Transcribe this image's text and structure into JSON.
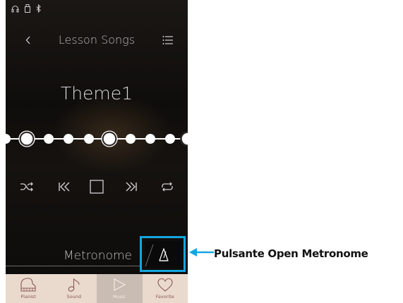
{
  "status_bar": {
    "icons": [
      "headphones-icon",
      "usb-memory-icon",
      "bluetooth-icon"
    ]
  },
  "header": {
    "title": "Lesson Songs",
    "back_icon": "chevron-left-icon",
    "menu_icon": "list-icon"
  },
  "song": {
    "title": "Theme1"
  },
  "progress": {
    "dot_count": 9,
    "selected_dots": [
      1,
      5
    ]
  },
  "controls": [
    "shuffle-icon",
    "skip-back-icon",
    "stop-icon",
    "skip-forward-icon",
    "repeat-icon"
  ],
  "metronome": {
    "label": "Metronome"
  },
  "tabs": [
    {
      "label": "Pianist",
      "icon": "piano-icon",
      "active": false
    },
    {
      "label": "Sound",
      "icon": "music-note-icon",
      "active": false
    },
    {
      "label": "Music",
      "icon": "play-icon",
      "active": true
    },
    {
      "label": "Favorite",
      "icon": "heart-icon",
      "active": false
    }
  ],
  "annotation": {
    "label": "Pulsante Open Metronome"
  },
  "colors": {
    "accent": "#13a6df",
    "tabbar": "#ead9cd",
    "tab_active": "#c9bcb2"
  }
}
